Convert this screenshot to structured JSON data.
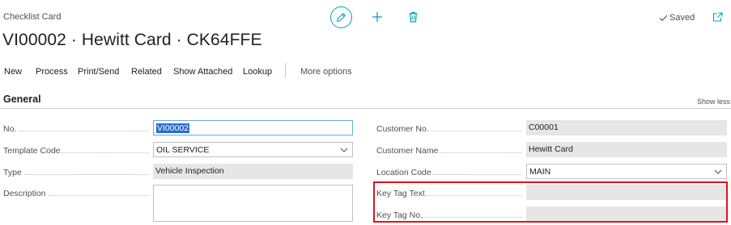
{
  "page": {
    "caption": "Checklist Card",
    "title": "VI00002 · Hewitt Card · CK64FFE",
    "saved_label": "Saved"
  },
  "header_icons": [
    "pencil-icon",
    "plus-icon",
    "trash-icon",
    "popout-icon"
  ],
  "actions": [
    "New",
    "Process",
    "Print/Send",
    "Related",
    "Show Attached",
    "Lookup"
  ],
  "more_options": "More options",
  "section": {
    "title": "General",
    "toggle_label": "Show less"
  },
  "fields": {
    "no": {
      "label": "No.",
      "value": "VI00002"
    },
    "template_code": {
      "label": "Template Code",
      "value": "OIL SERVICE"
    },
    "type": {
      "label": "Type",
      "value": "Vehicle Inspection"
    },
    "description": {
      "label": "Description",
      "value": ""
    },
    "customer_no": {
      "label": "Customer No.",
      "value": "C00001"
    },
    "customer_name": {
      "label": "Customer Name",
      "value": "Hewitt Card"
    },
    "location_code": {
      "label": "Location Code",
      "value": "MAIN"
    },
    "key_tag_text": {
      "label": "Key Tag Text",
      "value": ""
    },
    "key_tag_no": {
      "label": "Key Tag No.",
      "value": ""
    }
  },
  "colors": {
    "accent": "#00a3b8",
    "highlight": "#e0121a",
    "readonly_bg": "#e6e6e6",
    "selection": "#2d6bd0"
  }
}
